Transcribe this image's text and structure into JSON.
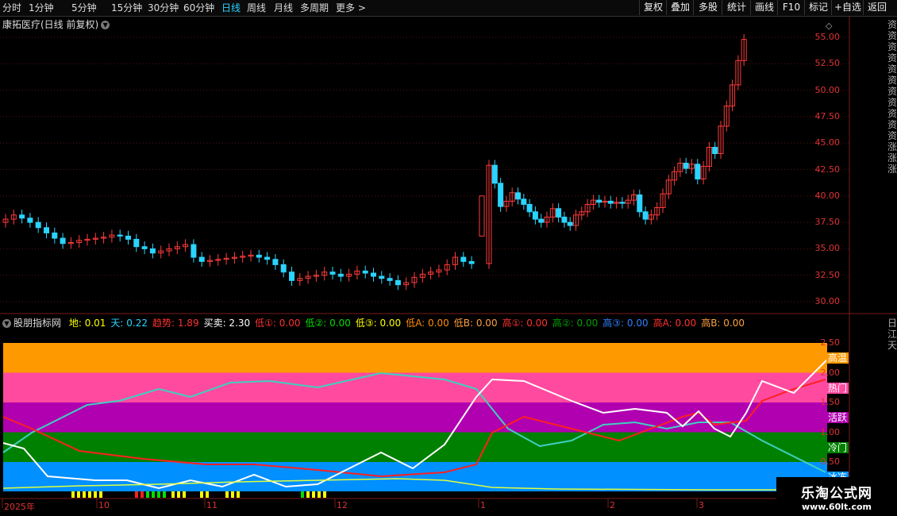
{
  "toolbar": {
    "periods": [
      "分时",
      "1分钟",
      "5分钟",
      "15分钟",
      "30分钟",
      "60分钟",
      "日线",
      "周线",
      "月线",
      "多周期",
      "更多 >"
    ],
    "active": "日线",
    "right": [
      "复权",
      "叠加",
      "多股",
      "统计",
      "画线",
      "F10",
      "标记",
      "+自选",
      "返回"
    ]
  },
  "chart_title": "康拓医疗(日线 前复权)",
  "price_axis": [
    "55.00",
    "52.50",
    "50.00",
    "47.50",
    "45.00",
    "42.50",
    "40.00",
    "37.50",
    "35.00",
    "32.50",
    "30.00"
  ],
  "indicator": {
    "name": "股朋指标网",
    "items": [
      {
        "label": "地:",
        "value": "0.01",
        "color": "#ffff00"
      },
      {
        "label": "天:",
        "value": "0.22",
        "color": "#2ad4ff"
      },
      {
        "label": "趋势:",
        "value": "1.89",
        "color": "#ff3030"
      },
      {
        "label": "买卖:",
        "value": "2.30",
        "color": "#ffffff"
      },
      {
        "label": "低①:",
        "value": "0.00",
        "color": "#ff3030"
      },
      {
        "label": "低②:",
        "value": "0.00",
        "color": "#00e000"
      },
      {
        "label": "低③:",
        "value": "0.00",
        "color": "#ffff00"
      },
      {
        "label": "低A:",
        "value": "0.00",
        "color": "#ff8c00"
      },
      {
        "label": "低B:",
        "value": "0.00",
        "color": "#ffa040"
      },
      {
        "label": "高①:",
        "value": "0.00",
        "color": "#ff3030"
      },
      {
        "label": "高②:",
        "value": "0.00",
        "color": "#00a000"
      },
      {
        "label": "高③:",
        "value": "0.00",
        "color": "#3080ff"
      },
      {
        "label": "高A:",
        "value": "0.00",
        "color": "#ff3030"
      },
      {
        "label": "高B:",
        "value": "0.00",
        "color": "#ffa040"
      }
    ]
  },
  "ind_axis": [
    "2.50",
    "2.00",
    "1.50",
    "1.00",
    "0.50"
  ],
  "zones": [
    {
      "label": "高温",
      "color": "#ff9900"
    },
    {
      "label": "热门",
      "color": "#ff4aa0"
    },
    {
      "label": "活跃",
      "color": "#b000b0"
    },
    {
      "label": "冷门",
      "color": "#008000"
    },
    {
      "label": "冰冻",
      "color": "#0090ff"
    }
  ],
  "x_axis": [
    "2025年",
    "10",
    "11",
    "12",
    "1",
    "2",
    "3"
  ],
  "side_text": "资资资资资资资资资资资涨涨涨",
  "side_text2": "日江天",
  "watermark": {
    "line1": "乐淘公式网",
    "line2": "www.60lt.com"
  },
  "colors": {
    "up": "#ff3b3b",
    "down": "#2ad4ff",
    "grid": "#5a1010"
  }
}
